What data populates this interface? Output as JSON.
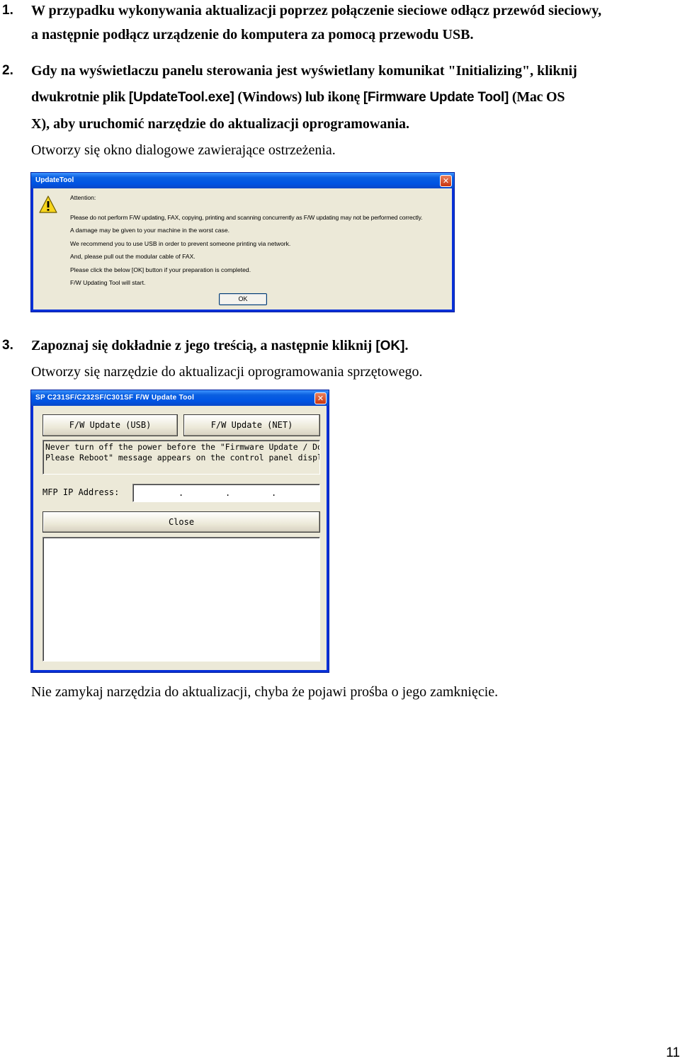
{
  "steps": [
    {
      "number": "1.",
      "lines": [
        "W przypadku wykonywania aktualizacji poprzez połączenie sieciowe odłącz przewód sieciowy,",
        "a następnie podłącz urządzenie do komputera za pomocą przewodu USB."
      ]
    },
    {
      "number": "2.",
      "line1": "Gdy na wyświetlaczu panelu sterowania jest wyświetlany komunikat \"Initializing\", kliknij",
      "line2_prefix": "dwukrotnie plik ",
      "line2_file": "[UpdateTool.exe]",
      "line2_mid": " (Windows) lub ikonę ",
      "line2_icon": "[Firmware Update Tool]",
      "line2_suffix": " (Mac OS",
      "line3": "X), aby uruchomić narzędzie do aktualizacji oprogramowania.",
      "note": "Otworzy się okno dialogowe zawierające ostrzeżenia."
    },
    {
      "number": "3.",
      "line1_prefix": "Zapoznaj się dokładnie z jego treścią, a następnie kliknij ",
      "line1_button": "[OK]",
      "line1_suffix": ".",
      "note": "Otworzy się narzędzie do aktualizacji oprogramowania sprzętowego."
    }
  ],
  "attention_dialog": {
    "title": "UpdateTool",
    "close_glyph": "✕",
    "heading": "Attention:",
    "messages": [
      "Please do not perform F/W updating, FAX, copying, printing and scanning concurrently as F/W updating may not be performed correctly.",
      "A damage may be given to your machine in the worst case.",
      "We recommend you to use USB in order to prevent someone printing via network.",
      "And, please pull out the modular cable of FAX.",
      "Please click the below [OK] button if your preparation is completed.",
      "F/W Updating Tool will start."
    ],
    "ok_label": "OK"
  },
  "update_tool_window": {
    "title": "SP C231SF/C232SF/C301SF F/W Update Tool",
    "close_glyph": "✕",
    "usb_button": "F/W Update (USB)",
    "net_button": "F/W Update (NET)",
    "notice_line1": "Never turn off the power before the \"Firmware Update / Done",
    "notice_line2": "Please Reboot\" message appears on the control panel display.",
    "ip_label": "MFP IP Address:",
    "ip_separator": ".",
    "close_button": "Close"
  },
  "footer_note": "Nie zamykaj narzędzia do aktualizacji, chyba że pojawi prośba o jego zamknięcie.",
  "page_number": "11",
  "colors": {
    "xp_title": "#0054e3",
    "xp_frame": "#0831d9",
    "dialog_face": "#ece9d8",
    "close_red": "#c9350f",
    "warning_yellow": "#f7d51d"
  }
}
